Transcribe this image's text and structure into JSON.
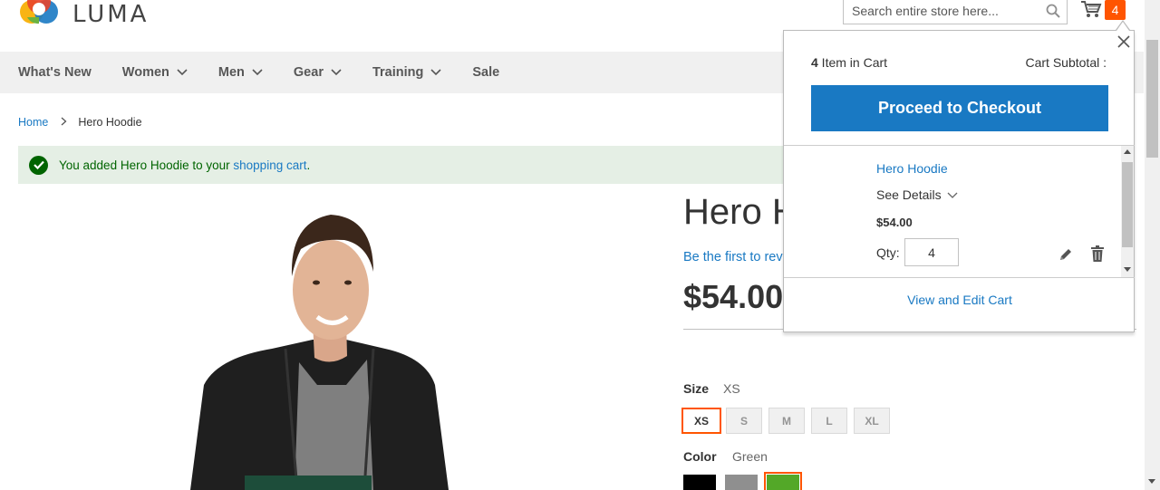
{
  "header": {
    "logo_text": "LUMA",
    "search_placeholder": "Search entire store here...",
    "cart_count": "4"
  },
  "nav": {
    "items": [
      {
        "label": "What's New",
        "has_children": false
      },
      {
        "label": "Women",
        "has_children": true
      },
      {
        "label": "Men",
        "has_children": true
      },
      {
        "label": "Gear",
        "has_children": true
      },
      {
        "label": "Training",
        "has_children": true
      },
      {
        "label": "Sale",
        "has_children": false
      }
    ]
  },
  "breadcrumb": {
    "home": "Home",
    "current": "Hero Hoodie"
  },
  "message": {
    "prefix": "You added Hero Hoodie to your ",
    "link": "shopping cart",
    "suffix": "."
  },
  "product": {
    "title": "Hero H",
    "review_link": "Be the first to rev",
    "price": "$54.00",
    "size_label": "Size",
    "size_selected": "XS",
    "sizes": [
      "XS",
      "S",
      "M",
      "L",
      "XL"
    ],
    "color_label": "Color",
    "color_selected": "Green",
    "colors": [
      "#000000",
      "#8f8f8f",
      "#53a828"
    ]
  },
  "minicart": {
    "count": "4",
    "count_suffix": " Item in Cart",
    "subtotal_label": "Cart Subtotal :",
    "checkout_label": "Proceed to Checkout",
    "item": {
      "name": "Hero Hoodie",
      "see_details": "See Details",
      "price": "$54.00",
      "qty_label": "Qty:",
      "qty": "4"
    },
    "view_edit_label": "View and Edit Cart"
  },
  "colors": {
    "accent_orange": "#ff5501",
    "link_blue": "#1979c3",
    "success_green": "#006400",
    "success_bg": "#e5efe5"
  }
}
